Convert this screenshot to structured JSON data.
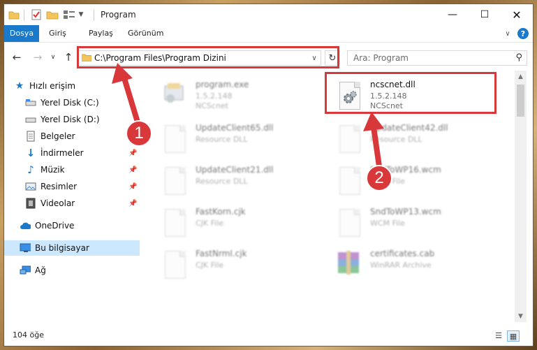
{
  "window": {
    "title": "Program"
  },
  "ribbon": {
    "tabs": [
      {
        "label": "Dosya"
      },
      {
        "label": "Giriş"
      },
      {
        "label": "Paylaş"
      },
      {
        "label": "Görünüm"
      }
    ]
  },
  "nav": {
    "address": "C:\\Program Files\\Program Dizini",
    "search_placeholder": "Ara: Program"
  },
  "sidebar": {
    "items": [
      {
        "label": "Hızlı erişim",
        "icon": "star-icon"
      },
      {
        "label": "Yerel Disk (C:)",
        "icon": "drive-icon"
      },
      {
        "label": "Yerel Disk (D:)",
        "icon": "drive-icon"
      },
      {
        "label": "Belgeler",
        "icon": "documents-icon"
      },
      {
        "label": "İndirmeler",
        "icon": "download-icon"
      },
      {
        "label": "Müzik",
        "icon": "music-icon"
      },
      {
        "label": "Resimler",
        "icon": "pictures-icon"
      },
      {
        "label": "Videolar",
        "icon": "videos-icon"
      },
      {
        "label": "OneDrive",
        "icon": "cloud-icon"
      },
      {
        "label": "Bu bilgisayar",
        "icon": "computer-icon"
      },
      {
        "label": "Ağ",
        "icon": "network-icon"
      }
    ]
  },
  "files": [
    {
      "name": "program.exe",
      "line1": "1.5.2.148",
      "line2": "NCScnet",
      "icon": "exe-icon"
    },
    {
      "name": "ncscnet.dll",
      "line1": "1.5.2.148",
      "line2": "NCScnet",
      "icon": "dll-gear-icon"
    },
    {
      "name": "UpdateClient65.dll",
      "line1": "Resource DLL",
      "icon": "dll-gear-icon"
    },
    {
      "name": "UpdateClient42.dll",
      "line1": "Resource DLL",
      "icon": "dll-gear-icon"
    },
    {
      "name": "UpdateClient21.dll",
      "line1": "Resource DLL",
      "icon": "dll-gear-icon"
    },
    {
      "name": "SndToWP16.wcm",
      "line1": "WCM File",
      "icon": "file-icon"
    },
    {
      "name": "FastKorn.cjk",
      "line1": "CJK File",
      "icon": "file-icon"
    },
    {
      "name": "SndToWP13.wcm",
      "line1": "WCM File",
      "icon": "file-icon"
    },
    {
      "name": "FastNrml.cjk",
      "line1": "CJK File",
      "icon": "file-icon"
    },
    {
      "name": "certificates.cab",
      "line1": "WinRAR Archive",
      "icon": "winrar-icon"
    }
  ],
  "status": {
    "count": "104 öğe"
  },
  "annotations": {
    "badge1": "1",
    "badge2": "2",
    "color": "#d9383a"
  }
}
